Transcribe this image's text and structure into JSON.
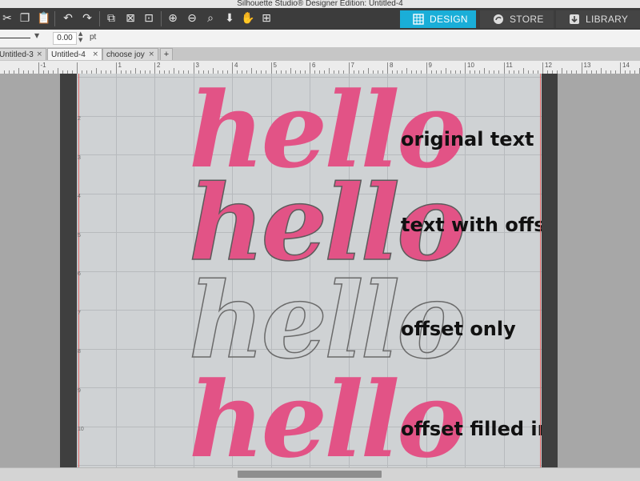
{
  "window": {
    "title": "Silhouette Studio® Designer Edition: Untitled-4"
  },
  "toolbar": {
    "icons": [
      "cut-icon",
      "copy-icon",
      "paste-icon",
      "undo-icon",
      "redo-icon",
      "group-icon",
      "ungroup-icon",
      "compound-path-icon",
      "zoom-in-icon",
      "zoom-out-icon",
      "zoom-select-icon",
      "move-down-icon",
      "pan-hand-icon",
      "fit-to-page-icon"
    ],
    "nav_tabs": [
      {
        "label": "DESIGN",
        "icon": "grid-icon",
        "active": true,
        "color": "#1aaed8"
      },
      {
        "label": "STORE",
        "icon": "store-icon",
        "active": false
      },
      {
        "label": "LIBRARY",
        "icon": "library-download-icon",
        "active": false
      }
    ]
  },
  "properties": {
    "line_width_value": "0.00",
    "line_width_unit": "pt"
  },
  "doc_tabs": [
    {
      "label": "Untitled-3",
      "active": false
    },
    {
      "label": "Untitled-4",
      "active": true
    },
    {
      "label": "choose joy",
      "active": false
    }
  ],
  "doc_tab_close": "×",
  "add_tab": "+",
  "ruler": {
    "top_labels": [
      "-1",
      "1",
      "2",
      "3",
      "4",
      "5",
      "6",
      "7",
      "8",
      "9",
      "10",
      "11",
      "12",
      "13",
      "14"
    ],
    "side_labels": [
      "2",
      "3",
      "4",
      "5",
      "6",
      "7",
      "8",
      "9",
      "10"
    ]
  },
  "canvas": {
    "word": "hello",
    "labels": {
      "original": "original text",
      "offset": "text with offset",
      "offset_only": "offset only",
      "filled": "offset filled in"
    },
    "colors": {
      "pink": "#e25386",
      "page": "#cfd2d4",
      "outline": "#6a6a6a"
    }
  }
}
